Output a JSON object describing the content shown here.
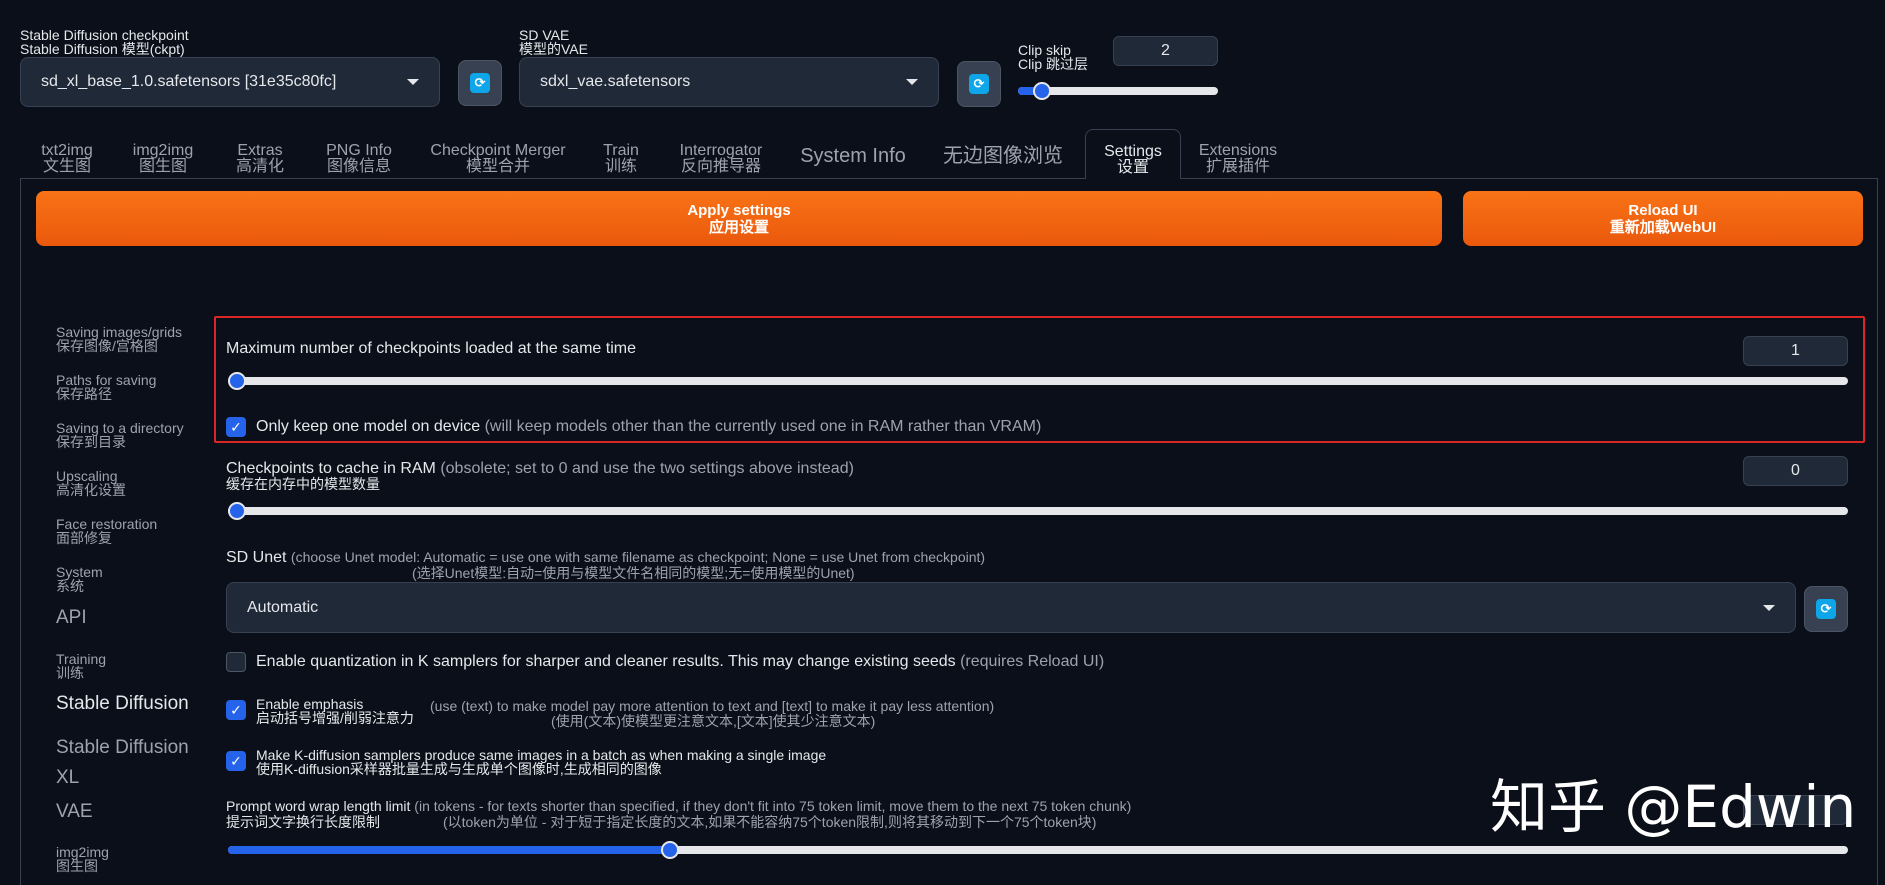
{
  "header": {
    "checkpoint": {
      "label_en": "Stable Diffusion checkpoint",
      "label_cn": "Stable Diffusion 模型(ckpt)",
      "value": "sd_xl_base_1.0.safetensors [31e35c80fc]"
    },
    "vae": {
      "label_en": "SD VAE",
      "label_cn": "模型的VAE",
      "value": "sdxl_vae.safetensors"
    },
    "clip_skip": {
      "label_en": "Clip skip",
      "label_cn": "Clip 跳过层",
      "value": "2",
      "slider_fraction": 0.12
    },
    "refresh_icon": "refresh-icon"
  },
  "tabs": [
    {
      "en": "txt2img",
      "cn": "文生图"
    },
    {
      "en": "img2img",
      "cn": "图生图"
    },
    {
      "en": "Extras",
      "cn": "高清化"
    },
    {
      "en": "PNG Info",
      "cn": "图像信息"
    },
    {
      "en": "Checkpoint Merger",
      "cn": "模型合并"
    },
    {
      "en": "Train",
      "cn": "训练"
    },
    {
      "en": "Interrogator",
      "cn": "反向推导器"
    },
    {
      "en": "System Info"
    },
    {
      "en": "无边图像浏览"
    },
    {
      "en": "Settings",
      "cn": "设置",
      "active": true
    },
    {
      "en": "Extensions",
      "cn": "扩展插件"
    }
  ],
  "buttons": {
    "apply_en": "Apply settings",
    "apply_cn": "应用设置",
    "reload_en": "Reload UI",
    "reload_cn": "重新加载WebUI"
  },
  "sidebar": [
    {
      "en": "Saving images/grids",
      "cn": "保存图像/宫格图"
    },
    {
      "en": "Paths for saving",
      "cn": "保存路径"
    },
    {
      "en": "Saving to a directory",
      "cn": "保存到目录"
    },
    {
      "en": "Upscaling",
      "cn": "高清化设置"
    },
    {
      "en": "Face restoration",
      "cn": "面部修复"
    },
    {
      "en": "System",
      "cn": "系统"
    },
    {
      "en": "API"
    },
    {
      "en": "Training",
      "cn": "训练"
    },
    {
      "en": "Stable Diffusion",
      "active": true
    },
    {
      "en": "Stable Diffusion XL"
    },
    {
      "en": "VAE"
    },
    {
      "en": "img2img",
      "cn": "图生图"
    }
  ],
  "settings": {
    "max_checkpoints": {
      "label": "Maximum number of checkpoints loaded at the same time",
      "value": "1",
      "slider_fraction": 0
    },
    "one_model": {
      "label": "Only keep one model on device",
      "note": "(will keep models other than the currently used one in RAM rather than VRAM)",
      "checked": true
    },
    "cache_ram": {
      "label": "Checkpoints to cache in RAM",
      "note": "(obsolete; set to 0 and use the two settings above instead)",
      "label_cn": "缓存在内存中的模型数量",
      "value": "0",
      "slider_fraction": 0
    },
    "sd_unet": {
      "label": "SD Unet",
      "note": "(choose Unet model: Automatic = use one with same filename as checkpoint; None = use Unet from checkpoint)",
      "note_cn": "(选择Unet模型:自动=使用与模型文件名相同的模型;无=使用模型的Unet)",
      "value": "Automatic"
    },
    "quantization": {
      "label": "Enable quantization in K samplers for sharper and cleaner results. This may change existing seeds",
      "note": "(requires Reload UI)",
      "checked": false
    },
    "emphasis": {
      "label": "Enable emphasis",
      "label_cn": "启动括号增强/削弱注意力",
      "note": "(use (text) to make model pay more attention to text and [text] to make it pay less attention)",
      "note_cn": "(使用(文本)使模型更注意文本,[文本]使其少注意文本)",
      "checked": true
    },
    "kdiffusion": {
      "label": "Make K-diffusion samplers produce same images in a batch as when making a single image",
      "label_cn": "使用K-diffusion采样器批量生成与生成单个图像时,生成相同的图像",
      "checked": true
    },
    "wrap_limit": {
      "label": "Prompt word wrap length limit",
      "note": "(in tokens - for texts shorter than specified, if they don't fit into 75 token limit, move them to the next 75 token chunk)",
      "label_cn": "提示词文字换行长度限制",
      "note_cn": "(以token为单位 - 对于短于指定长度的文本,如果不能容纳75个token限制,则将其移动到下一个75个token块)",
      "slider_fraction": 0.273
    }
  },
  "watermark": "知乎 @Edwin",
  "colors": {
    "accent": "#2563eb",
    "orange": "#ea580c",
    "highlight_border": "#dc2626",
    "background": "#0b0f19"
  }
}
